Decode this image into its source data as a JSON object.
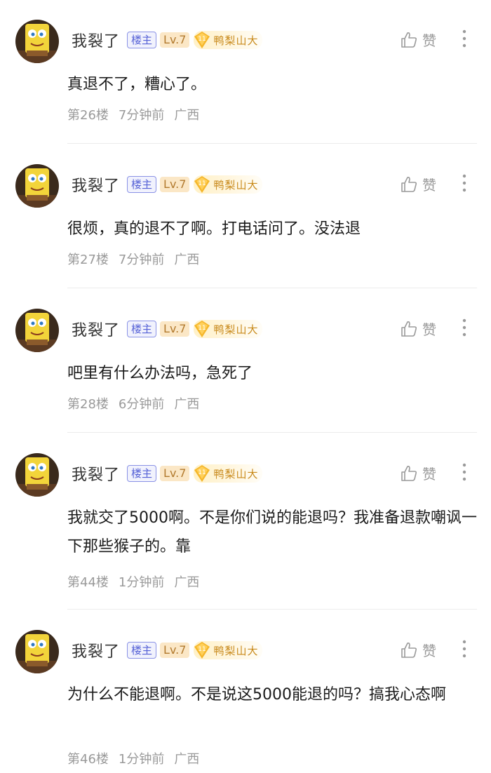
{
  "colors": {
    "op_badge_text": "#5460d6",
    "level_badge_bg": "#fbe7c6",
    "level_badge_text": "#b27a2e",
    "fan_badge_text": "#c8891a",
    "meta_text": "#9a9a9a"
  },
  "comments": [
    {
      "username": "我裂了",
      "op_badge": "楼主",
      "level": "Lv.7",
      "fan_level": "11",
      "fan_group": "鸭梨山大",
      "like_label": "赞",
      "content": "真退不了，糟心了。",
      "floor": "第26楼",
      "time": "7分钟前",
      "location": "广西"
    },
    {
      "username": "我裂了",
      "op_badge": "楼主",
      "level": "Lv.7",
      "fan_level": "11",
      "fan_group": "鸭梨山大",
      "like_label": "赞",
      "content": "很烦，真的退不了啊。打电话问了。没法退",
      "floor": "第27楼",
      "time": "7分钟前",
      "location": "广西"
    },
    {
      "username": "我裂了",
      "op_badge": "楼主",
      "level": "Lv.7",
      "fan_level": "11",
      "fan_group": "鸭梨山大",
      "like_label": "赞",
      "content": "吧里有什么办法吗，急死了",
      "floor": "第28楼",
      "time": "6分钟前",
      "location": "广西"
    },
    {
      "username": "我裂了",
      "op_badge": "楼主",
      "level": "Lv.7",
      "fan_level": "11",
      "fan_group": "鸭梨山大",
      "like_label": "赞",
      "content": "我就交了5000啊。不是你们说的能退吗？我准备退款嘲讽一下那些猴子的。靠",
      "floor": "第44楼",
      "time": "1分钟前",
      "location": "广西"
    },
    {
      "username": "我裂了",
      "op_badge": "楼主",
      "level": "Lv.7",
      "fan_level": "11",
      "fan_group": "鸭梨山大",
      "like_label": "赞",
      "content": "为什么不能退啊。不是说这5000能退的吗？搞我心态啊",
      "floor": "第46楼",
      "time": "1分钟前",
      "location": "广西"
    }
  ]
}
